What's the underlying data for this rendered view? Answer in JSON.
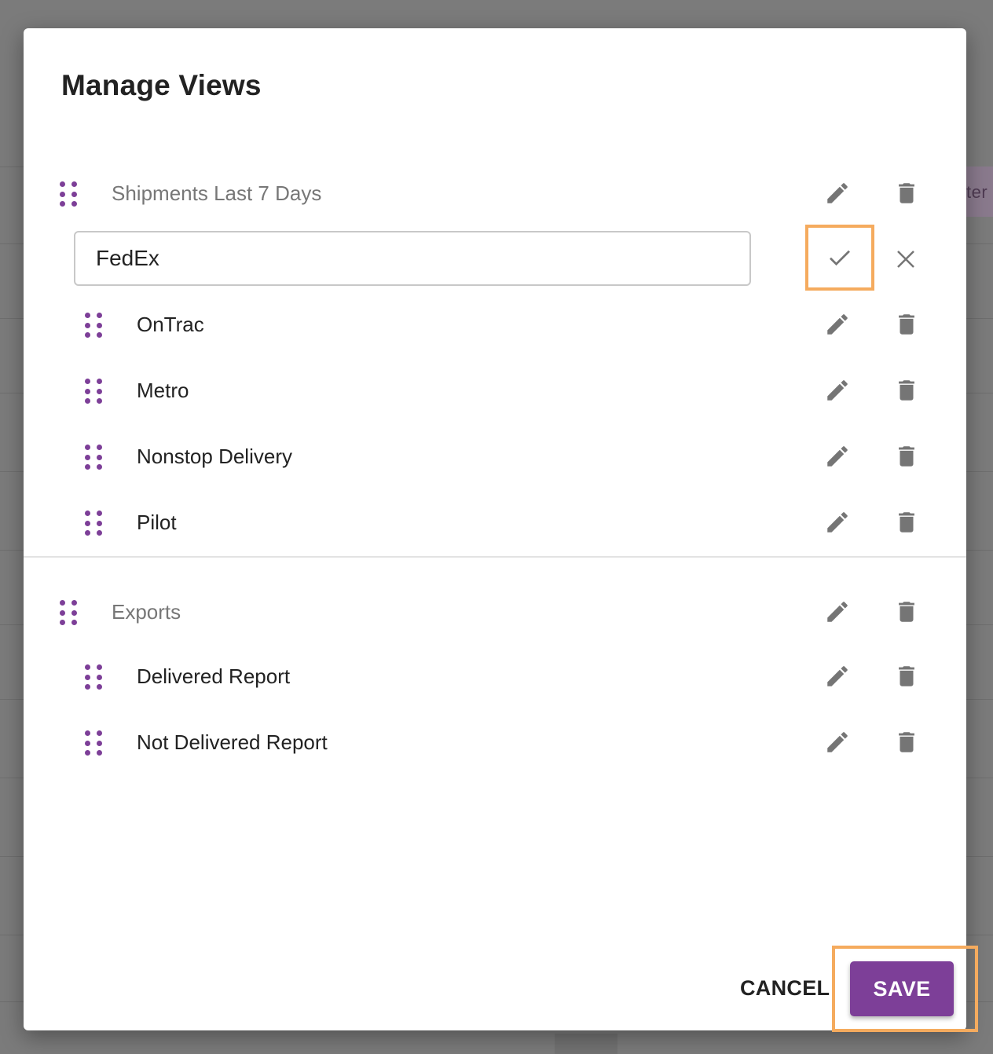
{
  "background": {
    "partial_chip_text": "ter"
  },
  "dialog": {
    "title": "Manage Views",
    "groups": [
      {
        "label": "Shipments Last 7 Days",
        "editing_item_value": "FedEx",
        "items": [
          "OnTrac",
          "Metro",
          "Nonstop Delivery",
          "Pilot"
        ]
      },
      {
        "label": "Exports",
        "items": [
          "Delivered Report",
          "Not Delivered Report"
        ]
      }
    ],
    "footer": {
      "cancel_label": "CANCEL",
      "save_label": "SAVE"
    }
  },
  "colors": {
    "accent": "#7d3f98",
    "highlight": "#f5ab5e",
    "icon": "#757575"
  },
  "icons": {
    "drag": "drag-handle-icon",
    "edit": "pencil-icon",
    "delete": "trash-icon",
    "confirm": "check-icon",
    "cancel": "close-icon"
  }
}
